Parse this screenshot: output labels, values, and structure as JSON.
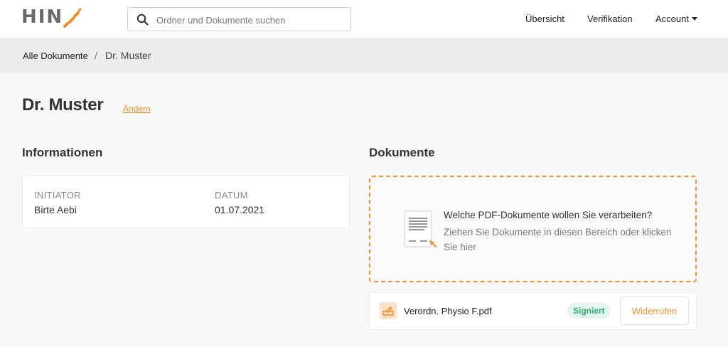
{
  "brand": {
    "logo_text": "HIN",
    "accent": "#f08a24"
  },
  "search": {
    "placeholder": "Ordner und Dokumente suchen"
  },
  "nav": {
    "overview": "Übersicht",
    "verification": "Verifikation",
    "account": "Account"
  },
  "breadcrumb": {
    "home": "Alle Dokumente",
    "separator": "/",
    "current": "Dr. Muster"
  },
  "page": {
    "title": "Dr. Muster",
    "change_link": "Ändern"
  },
  "info": {
    "section_title": "Informationen",
    "initiator_label": "INITIATOR",
    "initiator_value": "Birte Aebi",
    "date_label": "DATUM",
    "date_value": "01.07.2021"
  },
  "documents": {
    "section_title": "Dokumente",
    "dropzone_title": "Welche PDF-Dokumente wollen Sie verarbeiten?",
    "dropzone_subtitle": "Ziehen Sie Dokumente in diesen Bereich oder klicken Sie hier",
    "files": [
      {
        "name": "Verordn. Physio F.pdf",
        "status": "Signiert",
        "action": "Widerrufen"
      }
    ]
  }
}
